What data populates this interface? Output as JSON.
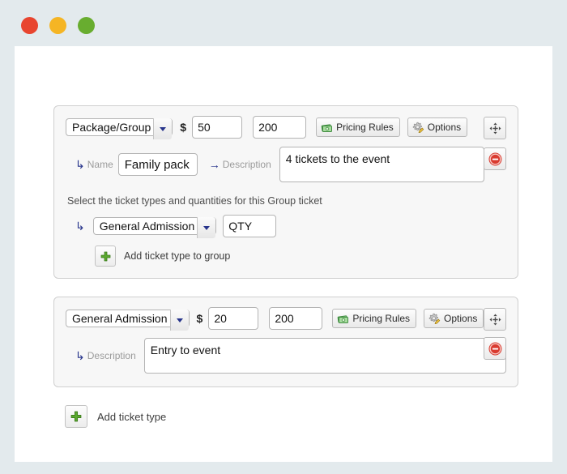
{
  "window": {
    "traffic_lights": [
      {
        "name": "close",
        "color": "#e8452f"
      },
      {
        "name": "minimize",
        "color": "#f5b524"
      },
      {
        "name": "maximize",
        "color": "#68ad2f"
      }
    ]
  },
  "tickets": [
    {
      "type_value": "Package/Group",
      "type_options": [
        "Package/Group",
        "General Admission"
      ],
      "currency_symbol": "$",
      "price": "50",
      "quantity": "200",
      "pricing_rules_label": "Pricing Rules",
      "pricing_rules_icon": "money-icon",
      "options_label": "Options",
      "options_icon": "gear-pencil-icon",
      "move_icon": "move-arrows-icon",
      "remove_icon": "remove-circle-icon",
      "name_label": "Name",
      "name_value": "Family pack",
      "name_arrow": "↳",
      "description_label": "Description",
      "description_arrow": "→",
      "description_value": "4 tickets to the event",
      "group": {
        "helper_text": "Select the ticket types and quantities for this Group ticket",
        "row_arrow": "↳",
        "member_type_value": "General Admission",
        "member_type_options": [
          "General Admission",
          "Package/Group"
        ],
        "qty_value": "QTY",
        "qty_placeholder": "QTY",
        "add_label": "Add ticket type to group",
        "add_icon": "plus-icon"
      }
    },
    {
      "type_value": "General Admission",
      "type_options": [
        "General Admission",
        "Package/Group"
      ],
      "currency_symbol": "$",
      "price": "20",
      "quantity": "200",
      "pricing_rules_label": "Pricing Rules",
      "pricing_rules_icon": "money-icon",
      "options_label": "Options",
      "options_icon": "gear-pencil-icon",
      "move_icon": "move-arrows-icon",
      "remove_icon": "remove-circle-icon",
      "description_label": "Description",
      "description_arrow": "↳",
      "description_value": "Entry to event"
    }
  ],
  "footer": {
    "add_ticket_label": "Add ticket type",
    "add_ticket_icon": "plus-icon"
  },
  "colors": {
    "desktop_background": "#e3eaed",
    "page_background": "#ffffff",
    "panel_background": "#f7f7f7",
    "panel_border": "#cfcfcf",
    "accent_arrow": "#27348b",
    "label_gray": "#9b9b9b",
    "plus_green": "#5aa82e",
    "remove_red": "#d93b30"
  }
}
